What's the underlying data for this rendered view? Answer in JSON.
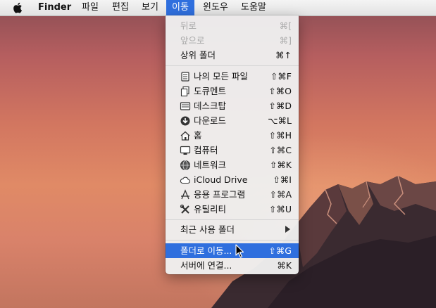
{
  "menubar": {
    "apple_icon": "apple-logo-icon",
    "items": [
      {
        "label": "Finder"
      },
      {
        "label": "파일"
      },
      {
        "label": "편집"
      },
      {
        "label": "보기"
      },
      {
        "label": "이동"
      },
      {
        "label": "윈도우"
      },
      {
        "label": "도움말"
      }
    ],
    "active_index": 4
  },
  "go_menu": {
    "items": [
      {
        "label": "뒤로",
        "shortcut": "⌘[",
        "enabled": false
      },
      {
        "label": "앞으로",
        "shortcut": "⌘]",
        "enabled": false
      },
      {
        "label": "상위 폴더",
        "shortcut": "⌘↑",
        "enabled": true
      },
      {
        "label": "나의 모든 파일",
        "shortcut": "⇧⌘F",
        "icon": "all-my-files-icon"
      },
      {
        "label": "도큐멘트",
        "shortcut": "⇧⌘O",
        "icon": "documents-icon"
      },
      {
        "label": "데스크탑",
        "shortcut": "⇧⌘D",
        "icon": "desktop-icon"
      },
      {
        "label": "다운로드",
        "shortcut": "⌥⌘L",
        "icon": "downloads-icon"
      },
      {
        "label": "홈",
        "shortcut": "⇧⌘H",
        "icon": "home-icon"
      },
      {
        "label": "컴퓨터",
        "shortcut": "⇧⌘C",
        "icon": "computer-icon"
      },
      {
        "label": "네트워크",
        "shortcut": "⇧⌘K",
        "icon": "network-icon"
      },
      {
        "label": "iCloud Drive",
        "shortcut": "⇧⌘I",
        "icon": "icloud-icon"
      },
      {
        "label": "응용 프로그램",
        "shortcut": "⇧⌘A",
        "icon": "applications-icon"
      },
      {
        "label": "유틸리티",
        "shortcut": "⇧⌘U",
        "icon": "utilities-icon"
      },
      {
        "label": "최근 사용 폴더",
        "has_submenu": true
      },
      {
        "label": "폴더로 이동...",
        "shortcut": "⇧⌘G",
        "highlighted": true
      },
      {
        "label": "서버에 연결...",
        "shortcut": "⌘K"
      }
    ]
  },
  "colors": {
    "highlight": "#2f6fde",
    "disabled_text": "#a9a9a9"
  }
}
